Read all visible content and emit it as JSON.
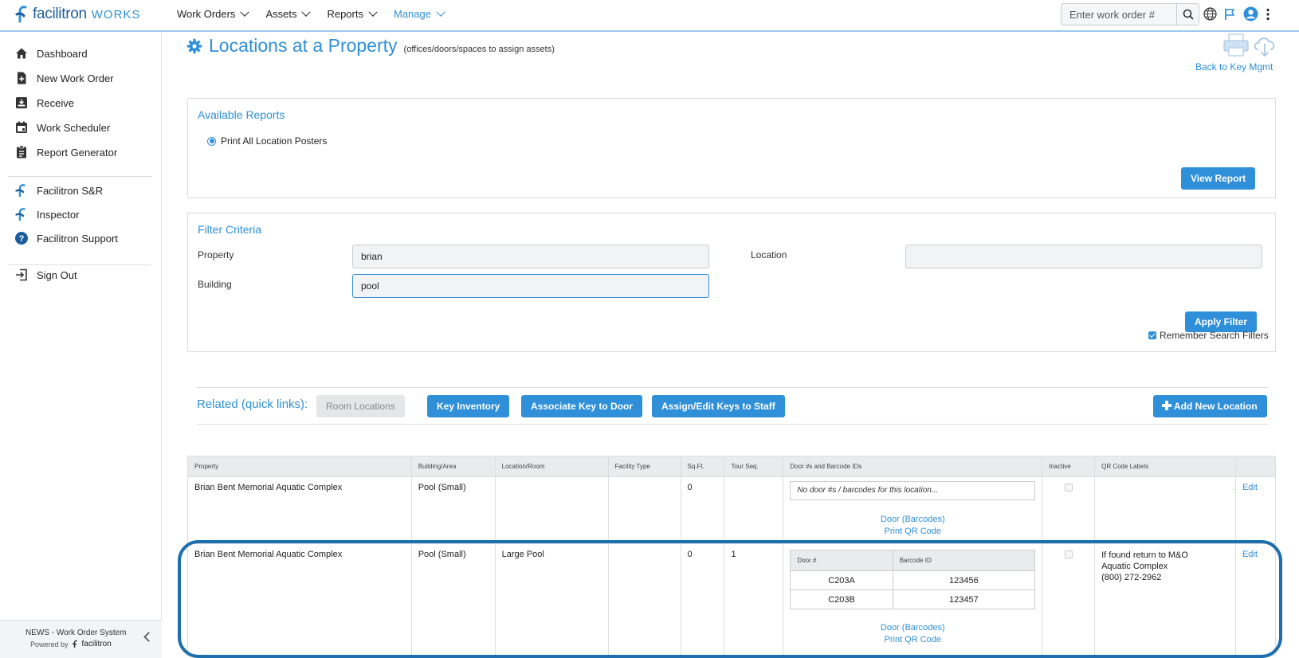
{
  "app": {
    "logo_text": "facilitron",
    "logo_works": "WORKS",
    "nav": [
      {
        "label": "Work Orders"
      },
      {
        "label": "Assets"
      },
      {
        "label": "Reports"
      },
      {
        "label": "Manage"
      }
    ],
    "search_placeholder": "Enter work order #",
    "accent": "#2f8fd8"
  },
  "sidebar": {
    "items": [
      {
        "label": "Dashboard",
        "icon": "home-icon"
      },
      {
        "label": "New Work Order",
        "icon": "plus-doc-icon"
      },
      {
        "label": "Receive",
        "icon": "inbox-icon"
      },
      {
        "label": "Work Scheduler",
        "icon": "calendar-icon"
      },
      {
        "label": "Report Generator",
        "icon": "clipboard-icon"
      },
      {
        "label": "Facilitron S&R",
        "icon": "facilitron-icon"
      },
      {
        "label": "Inspector",
        "icon": "facilitron-icon"
      },
      {
        "label": "Facilitron Support",
        "icon": "help-icon"
      },
      {
        "label": "Sign Out",
        "icon": "sign-out-icon"
      }
    ],
    "footer_title": "NEWS - Work Order System",
    "footer_powered": "Powered by",
    "footer_brand": "facilitron"
  },
  "page": {
    "title": "Locations at a Property",
    "subtitle": "(offices/doors/spaces to assign assets)",
    "back_link": "Back to Key Mgmt"
  },
  "reports": {
    "title": "Available Reports",
    "option": "Print All Location Posters",
    "view_button": "View Report"
  },
  "filter": {
    "title": "Filter Criteria",
    "property_label": "Property",
    "property_value": "brian",
    "building_label": "Building",
    "building_value": "pool",
    "location_label": "Location",
    "location_value": "",
    "apply_button": "Apply Filter",
    "remember_label": "Remember Search Filters"
  },
  "related": {
    "label": "Related (quick links):",
    "room_locations": "Room Locations",
    "key_inventory": "Key Inventory",
    "associate": "Associate Key to Door",
    "assign": "Assign/Edit Keys to Staff",
    "add_new": "Add New Location"
  },
  "table": {
    "headers": [
      "Property",
      "Building/Area",
      "Location/Room",
      "Facility Type",
      "Sq.Ft.",
      "Tour Seq.",
      "Door #s and Barcode IDs",
      "Inactive",
      "QR Code Labels",
      ""
    ],
    "rows": [
      {
        "property": "Brian Bent Memorial Aquatic Complex",
        "building": "Pool (Small)",
        "location": "",
        "facility_type": "",
        "sqft": "0",
        "tour_seq": "",
        "no_door_text": "No door #s / barcodes for this location...",
        "door_link": "Door (Barcodes)",
        "qr_link": "Print QR Code",
        "qr_label_1": "",
        "edit": "Edit"
      },
      {
        "property": "Brian Bent Memorial Aquatic Complex",
        "building": "Pool (Small)",
        "location": "Large Pool",
        "facility_type": "",
        "sqft": "0",
        "tour_seq": "1",
        "door_header": "Door #",
        "barcode_header": "Barcode ID",
        "doors": [
          {
            "door": "C203A",
            "barcode": "123456"
          },
          {
            "door": "C203B",
            "barcode": "123457"
          }
        ],
        "door_link": "Door (Barcodes)",
        "qr_link": "Print QR Code",
        "qr_label_1": "If found return to M&O",
        "qr_label_2": "Aquatic Complex",
        "qr_label_3": "(800) 272-2962",
        "edit": "Edit"
      }
    ]
  }
}
